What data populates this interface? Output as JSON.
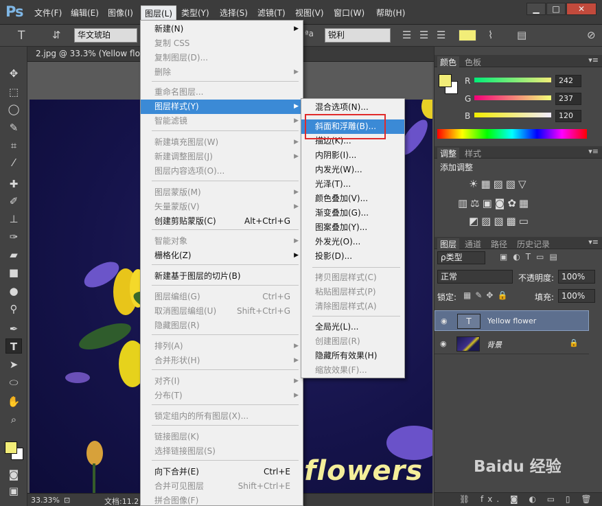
{
  "app": {
    "logo": "Ps"
  },
  "menubar": {
    "items": [
      "文件(F)",
      "编辑(E)",
      "图像(I)",
      "图层(L)",
      "类型(Y)",
      "选择(S)",
      "滤镜(T)",
      "视图(V)",
      "窗口(W)",
      "帮助(H)"
    ],
    "window_buttons": [
      "▁",
      "□",
      "✕"
    ]
  },
  "options": {
    "font_family": "华文琥珀",
    "antialias": "锐利",
    "aa_label": "ªa",
    "text_color": "#f2ed78"
  },
  "document": {
    "tab_label": "2.jpg @ 33.3% (Yellow flowe",
    "zoom": "33.33%",
    "doc_info": "文档:11.2",
    "canvas_text": "flowers"
  },
  "layer_menu": {
    "items": [
      {
        "label": "新建(N)",
        "disabled": false,
        "submenu": true
      },
      {
        "label": "复制 CSS",
        "disabled": true
      },
      {
        "label": "复制图层(D)...",
        "disabled": true
      },
      {
        "label": "删除",
        "disabled": true,
        "submenu": true
      },
      {
        "label": "重命名图层...",
        "disabled": true
      },
      {
        "label": "图层样式(Y)",
        "disabled": false,
        "submenu": true,
        "highlight": true
      },
      {
        "label": "智能滤镜",
        "disabled": true,
        "submenu": true
      },
      {
        "label": "新建填充图层(W)",
        "disabled": true,
        "submenu": true
      },
      {
        "label": "新建调整图层(J)",
        "disabled": true,
        "submenu": true
      },
      {
        "label": "图层内容选项(O)...",
        "disabled": true
      },
      {
        "label": "图层蒙版(M)",
        "disabled": true,
        "submenu": true
      },
      {
        "label": "矢量蒙版(V)",
        "disabled": true,
        "submenu": true
      },
      {
        "label": "创建剪贴蒙版(C)",
        "disabled": false,
        "shortcut": "Alt+Ctrl+G"
      },
      {
        "label": "智能对象",
        "disabled": true,
        "submenu": true
      },
      {
        "label": "栅格化(Z)",
        "disabled": false,
        "submenu": true
      },
      {
        "label": "新建基于图层的切片(B)",
        "disabled": false
      },
      {
        "label": "图层编组(G)",
        "disabled": true,
        "shortcut": "Ctrl+G"
      },
      {
        "label": "取消图层编组(U)",
        "disabled": true,
        "shortcut": "Shift+Ctrl+G"
      },
      {
        "label": "隐藏图层(R)",
        "disabled": true
      },
      {
        "label": "排列(A)",
        "disabled": true,
        "submenu": true
      },
      {
        "label": "合并形状(H)",
        "disabled": true,
        "submenu": true
      },
      {
        "label": "对齐(I)",
        "disabled": true,
        "submenu": true
      },
      {
        "label": "分布(T)",
        "disabled": true,
        "submenu": true
      },
      {
        "label": "锁定组内的所有图层(X)...",
        "disabled": true
      },
      {
        "label": "链接图层(K)",
        "disabled": true
      },
      {
        "label": "选择链接图层(S)",
        "disabled": true
      },
      {
        "label": "向下合并(E)",
        "disabled": false,
        "shortcut": "Ctrl+E"
      },
      {
        "label": "合并可见图层",
        "disabled": true,
        "shortcut": "Shift+Ctrl+E"
      },
      {
        "label": "拼合图像(F)",
        "disabled": true
      }
    ]
  },
  "style_submenu": {
    "items": [
      {
        "label": "混合选项(N)...",
        "disabled": false
      },
      {
        "label": "斜面和浮雕(B)...",
        "disabled": false,
        "highlight": true
      },
      {
        "label": "描边(K)...",
        "disabled": false
      },
      {
        "label": "内阴影(I)...",
        "disabled": false
      },
      {
        "label": "内发光(W)...",
        "disabled": false
      },
      {
        "label": "光泽(T)...",
        "disabled": false
      },
      {
        "label": "颜色叠加(V)...",
        "disabled": false
      },
      {
        "label": "渐变叠加(G)...",
        "disabled": false
      },
      {
        "label": "图案叠加(Y)...",
        "disabled": false
      },
      {
        "label": "外发光(O)...",
        "disabled": false
      },
      {
        "label": "投影(D)...",
        "disabled": false
      },
      {
        "label": "拷贝图层样式(C)",
        "disabled": true
      },
      {
        "label": "粘贴图层样式(P)",
        "disabled": true
      },
      {
        "label": "清除图层样式(A)",
        "disabled": true
      },
      {
        "label": "全局光(L)...",
        "disabled": false
      },
      {
        "label": "创建图层(R)",
        "disabled": true
      },
      {
        "label": "隐藏所有效果(H)",
        "disabled": false
      },
      {
        "label": "缩放效果(F)...",
        "disabled": true
      }
    ]
  },
  "color_panel": {
    "tabs": [
      "颜色",
      "色板"
    ],
    "channels": [
      {
        "label": "R",
        "value": "242"
      },
      {
        "label": "G",
        "value": "237"
      },
      {
        "label": "B",
        "value": "120"
      }
    ],
    "fg_color": "#f2ed78"
  },
  "adjust_panel": {
    "tabs": [
      "调整",
      "样式"
    ],
    "title": "添加调整"
  },
  "layers_panel": {
    "tabs": [
      "图层",
      "通道",
      "路径",
      "历史记录"
    ],
    "filter_kind": "ρ类型",
    "blend_mode": "正常",
    "opacity_label": "不透明度:",
    "opacity": "100%",
    "lock_label": "锁定:",
    "fill_label": "填充:",
    "fill": "100%",
    "layers": [
      {
        "name": "Yellow flower",
        "selected": true
      },
      {
        "name": "背景",
        "selected": false
      }
    ],
    "footer_icons": "⛓ fx. ◙ ◐ ▭ ▯ 🗑"
  },
  "watermark": "Baidu 经验"
}
